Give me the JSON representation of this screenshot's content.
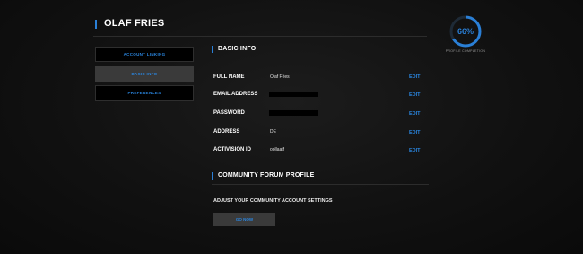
{
  "header": {
    "user_name": "OLAF FRIES"
  },
  "profile": {
    "completion_percent": 66,
    "completion_text": "66%",
    "completion_label": "PROFILE COMPLETION",
    "accent": "#2a7fd6"
  },
  "nav": {
    "account_linking": "ACCOUNT LINKING",
    "basic_info": "BASIC INFO",
    "preferences": "PREFERENCES"
  },
  "basic_info": {
    "title": "BASIC INFO",
    "rows": [
      {
        "label": "FULL NAME",
        "value": "Olaf Fries",
        "edit": "EDIT"
      },
      {
        "label": "EMAIL ADDRESS",
        "value": "",
        "edit": "EDIT"
      },
      {
        "label": "PASSWORD",
        "value": "",
        "edit": "EDIT"
      },
      {
        "label": "ADDRESS",
        "value": "DE",
        "edit": "EDIT"
      },
      {
        "label": "ACTIVISION ID",
        "value": "oollaaff",
        "edit": "EDIT"
      }
    ]
  },
  "forum": {
    "title": "COMMUNITY FORUM PROFILE",
    "description": "ADJUST YOUR COMMUNITY ACCOUNT SETTINGS",
    "button": "GO NOW"
  }
}
